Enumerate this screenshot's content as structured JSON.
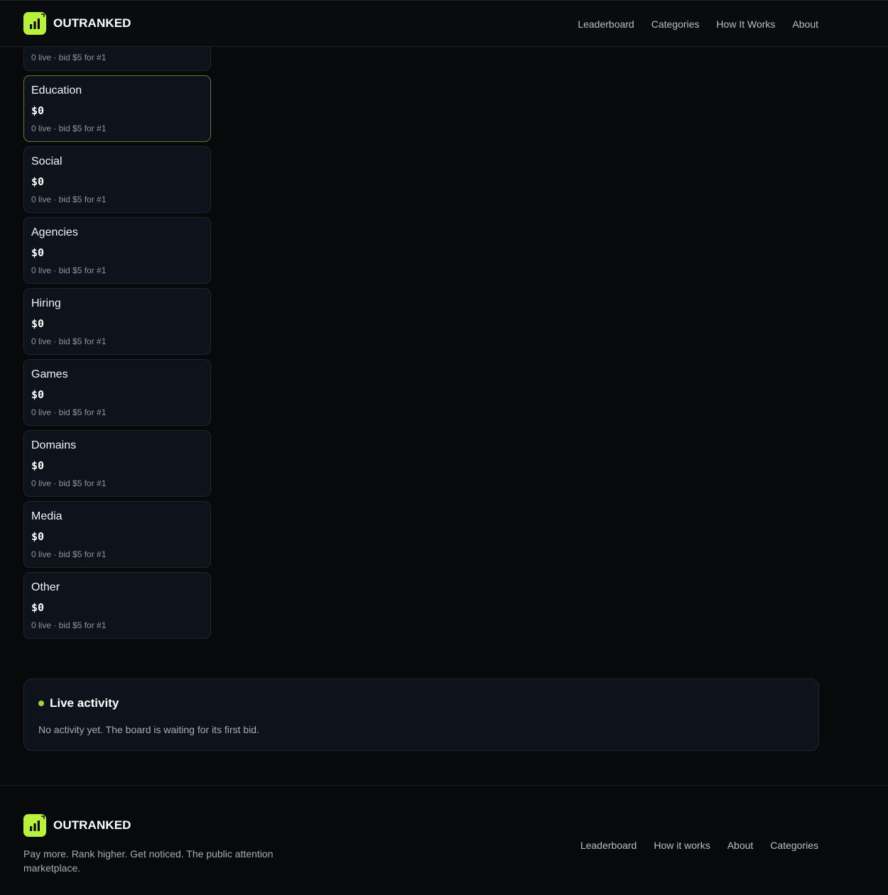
{
  "header": {
    "brand": "OUTRANKED",
    "nav": [
      "Leaderboard",
      "Categories",
      "How It Works",
      "About"
    ]
  },
  "categories": [
    {
      "name": "",
      "price": "",
      "meta": "0 live · bid $5 for #1"
    },
    {
      "name": "Education",
      "price": "$0",
      "meta": "0 live · bid $5 for #1"
    },
    {
      "name": "Social",
      "price": "$0",
      "meta": "0 live · bid $5 for #1"
    },
    {
      "name": "Agencies",
      "price": "$0",
      "meta": "0 live · bid $5 for #1"
    },
    {
      "name": "Hiring",
      "price": "$0",
      "meta": "0 live · bid $5 for #1"
    },
    {
      "name": "Games",
      "price": "$0",
      "meta": "0 live · bid $5 for #1"
    },
    {
      "name": "Domains",
      "price": "$0",
      "meta": "0 live · bid $5 for #1"
    },
    {
      "name": "Media",
      "price": "$0",
      "meta": "0 live · bid $5 for #1"
    },
    {
      "name": "Other",
      "price": "$0",
      "meta": "0 live · bid $5 for #1"
    }
  ],
  "activity": {
    "title": "Live activity",
    "empty": "No activity yet. The board is waiting for its first bid."
  },
  "footer": {
    "brand": "OUTRANKED",
    "tagline": "Pay more. Rank higher. Get noticed. The public attention marketplace.",
    "nav": [
      "Leaderboard",
      "How it works",
      "About",
      "Categories"
    ]
  },
  "colors": {
    "accent": "#b8f23a",
    "background": "#08090b",
    "card": "#0e131b"
  },
  "icons": {
    "logo": "bar-chart-icon"
  }
}
